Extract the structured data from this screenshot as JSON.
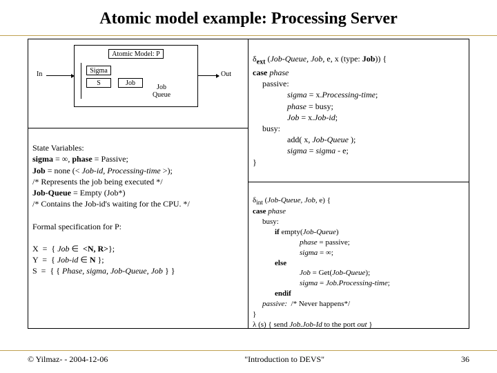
{
  "title": "Atomic model example: Processing Server",
  "diagram": {
    "model_title": "Atomic Model: P",
    "in_label": "In",
    "out_label": "Out",
    "sigma": "Sigma",
    "s": "S",
    "job": "Job",
    "job_queue": "Job\nQueue"
  },
  "left_mid": {
    "hdr": "State Variables:",
    "l1a": "sigma",
    "l1b": " = ∞, ",
    "l1c": "phase",
    "l1d": " = Passive;",
    "l2a": "Job",
    "l2b": " = none (< ",
    "l2c": "Job-id, Processing-time",
    "l2d": " >);",
    "l3": "/* Represents the job being executed */",
    "l4a": "Job-Queue",
    "l4b": " = Empty (Job*)",
    "l5": "/* Contains the Job-id's waiting for the CPU. */",
    "spec_hdr": "Formal specification for P:",
    "x1": "X  =  { ",
    "x2": "Job",
    "x3": " ∈  ",
    "x4": "<N, R>",
    "x5": "};",
    "y1": "Y  =  { ",
    "y2": "Job-id",
    "y3": " ∈ ",
    "y4": "N",
    "y5": " };",
    "s1": "S  =  { { ",
    "s2": "Phase, sigma, Job-Queue, Job",
    "s3": " } }"
  },
  "right_top": {
    "sig": "δ",
    "sub": "ext",
    "args": " (",
    "a1": "Job-Queue, Job,",
    "a2": " e, x (type: ",
    "a3": "Job",
    "a4": ")) {",
    "case": "case ",
    "phase": "phase",
    "passive": "passive:",
    "p1a": "sigma",
    "p1b": " = x.",
    "p1c": "Processing-time",
    "p1d": ";",
    "p2a": "phase",
    "p2b": " = busy;",
    "p3a": "Job",
    "p3b": " = x.",
    "p3c": "Job-id",
    "p3d": ";",
    "busy": "busy:",
    "b1a": "add( x, ",
    "b1b": "Job-Queue",
    "b1c": " );",
    "b2a": "sigma",
    "b2b": " = ",
    "b2c": "sigma",
    "b2d": " - e;",
    "close": "}"
  },
  "right_bot": {
    "d1": "δ",
    "dsub": "int",
    "dargs": " (",
    "da": "Job-Queue, Job,",
    "de": " e) {",
    "case": "case ",
    "phase": "phase",
    "busy": "busy:",
    "if1": "if ",
    "emp": "empty(",
    "jq": "Job-Queue",
    "rp": ")",
    "t1a": "phase",
    "t1b": " = passive;",
    "t2a": "sigma",
    "t2b": " = ∞;",
    "else": "else",
    "e1a": "Job ",
    "e1b": "= Get(",
    "e1c": "Job-Queue",
    "e1d": ");",
    "e2a": "sigma ",
    "e2b": "= ",
    "e2c": "Job.Processing-time",
    "e2d": ";",
    "endif": "endif",
    "pass": "passive: ",
    "never": " /* Never happens*/",
    "close": "}",
    "lam": "λ (s) { send ",
    "ljob": "Job.Job-Id",
    "lto": " to the port ",
    "lout": "out",
    "lcl": " }"
  },
  "footer": {
    "left": "© Yilmaz- -  2004-12-06",
    "center": "\"Introduction to DEVS\"",
    "right": "36"
  }
}
